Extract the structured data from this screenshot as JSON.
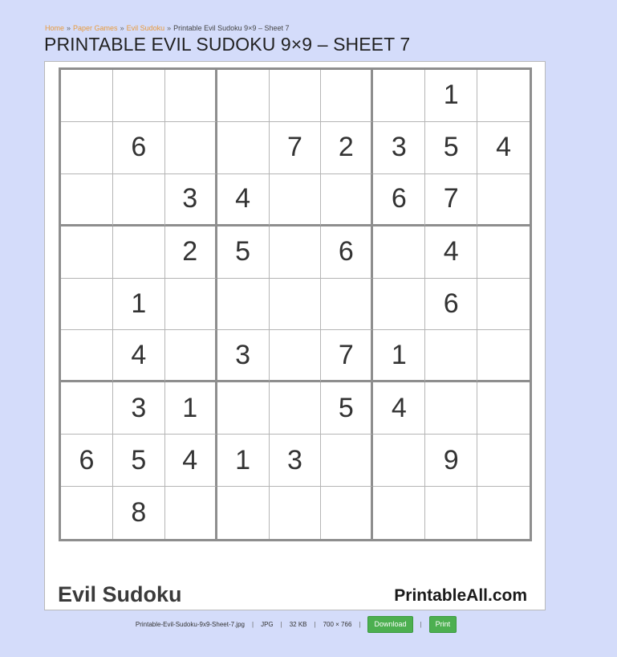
{
  "breadcrumb": {
    "items": [
      "Home",
      "Paper Games",
      "Evil Sudoku"
    ],
    "current": "Printable Evil Sudoku 9×9 – Sheet 7",
    "separator": "»"
  },
  "page_title": "PRINTABLE EVIL SUDOKU 9×9 – SHEET 7",
  "puzzle": {
    "grid": [
      [
        "",
        "",
        "",
        "",
        "",
        "",
        "",
        "1",
        ""
      ],
      [
        "",
        "6",
        "",
        "",
        "7",
        "2",
        "3",
        "5",
        "4"
      ],
      [
        "",
        "",
        "3",
        "4",
        "",
        "",
        "6",
        "7",
        ""
      ],
      [
        "",
        "",
        "2",
        "5",
        "",
        "6",
        "",
        "4",
        ""
      ],
      [
        "",
        "1",
        "",
        "",
        "",
        "",
        "",
        "6",
        ""
      ],
      [
        "",
        "4",
        "",
        "3",
        "",
        "7",
        "1",
        "",
        ""
      ],
      [
        "",
        "3",
        "1",
        "",
        "",
        "5",
        "4",
        "",
        ""
      ],
      [
        "6",
        "5",
        "4",
        "1",
        "3",
        "",
        "",
        "9",
        ""
      ],
      [
        "",
        "8",
        "",
        "",
        "",
        "",
        "",
        "",
        ""
      ]
    ],
    "caption": "Evil Sudoku",
    "brand": "PrintableAll.com"
  },
  "file_info": {
    "filename": "Printable-Evil-Sudoku-9x9-Sheet-7.jpg",
    "format": "JPG",
    "size": "32 KB",
    "dimensions": "700 × 766",
    "separator": "|"
  },
  "buttons": {
    "download_label": "Download",
    "print_label": "Print"
  },
  "colors": {
    "page_background": "#d4dcfa",
    "breadcrumb_link": "#e89a3c",
    "button_green": "#4caf50"
  }
}
